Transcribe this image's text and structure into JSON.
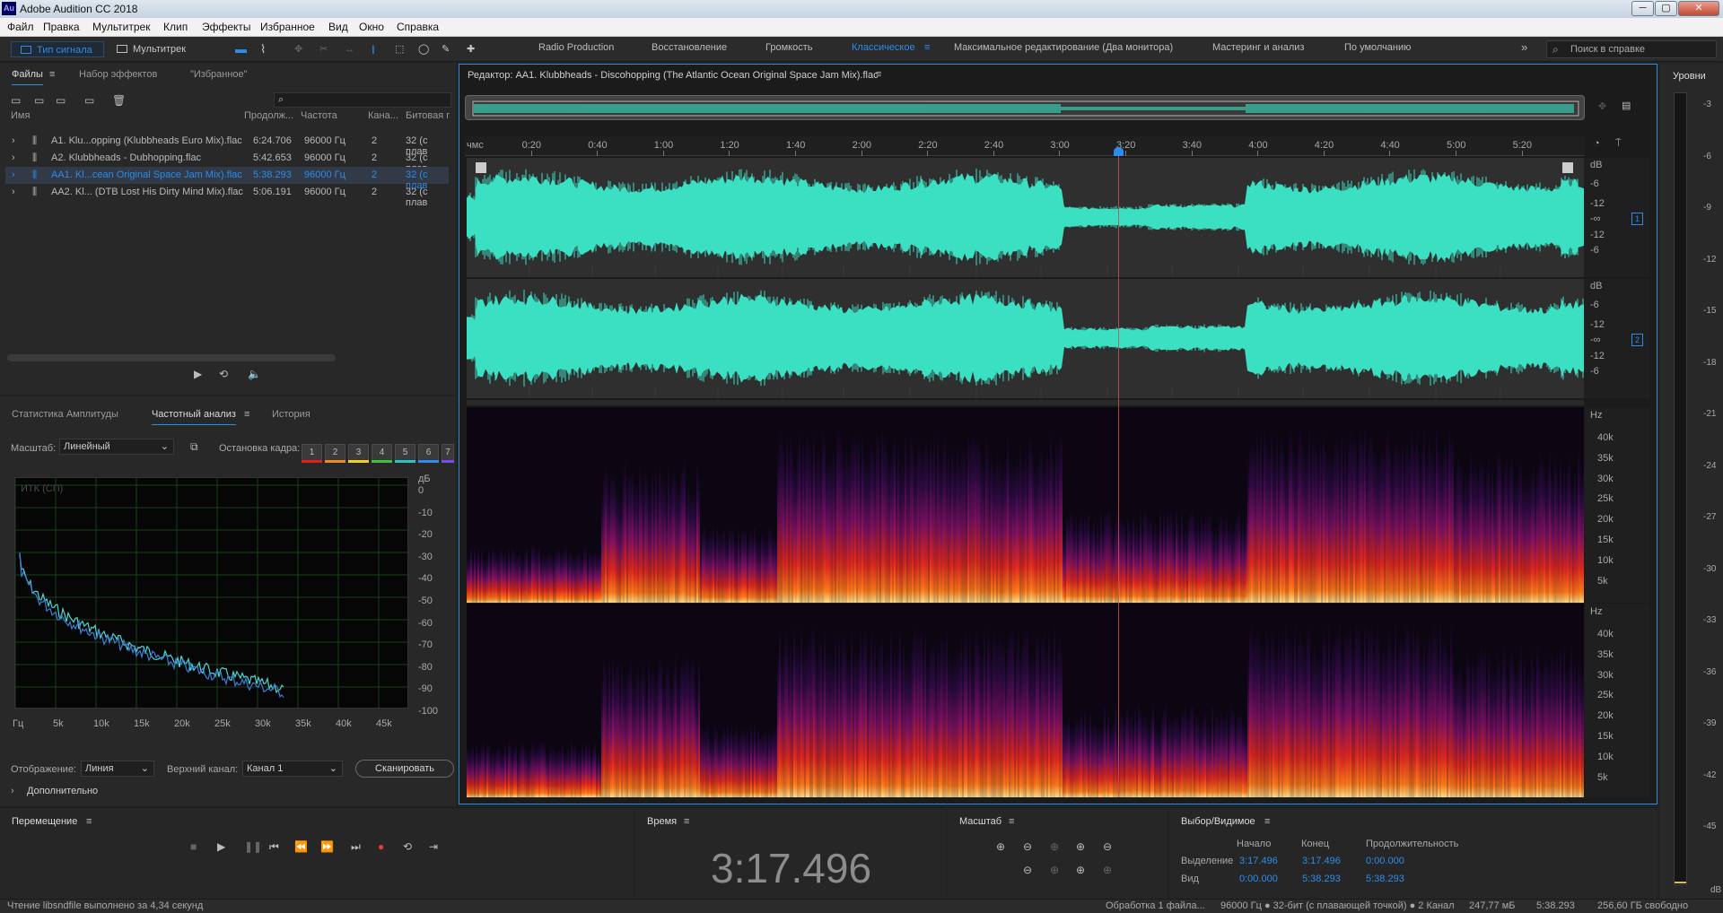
{
  "window": {
    "title": "Adobe Audition CC 2018",
    "logo": "Au",
    "min": "─",
    "max": "▢",
    "close": "✕"
  },
  "menu": [
    "Файл",
    "Правка",
    "Мультитрек",
    "Клип",
    "Эффекты",
    "Избранное",
    "Вид",
    "Окно",
    "Справка"
  ],
  "toolbar": {
    "waveform_btn": "Тип сигнала",
    "multitrack_btn": "Мультитрек",
    "workspaces": [
      "Radio Production",
      "Восстановление",
      "Громкость",
      "Классическое",
      "Максимальное редактирование (Два монитора)",
      "Мастеринг и анализ",
      "По умолчанию"
    ],
    "active_workspace": "Классическое",
    "more": "»",
    "search_placeholder": "Поиск в справке"
  },
  "files_panel": {
    "tabs": [
      "Файлы",
      "Набор эффектов",
      "\"Избранное\""
    ],
    "columns": [
      "Имя",
      "Продолж...",
      "Частота",
      "Кана...",
      "Битовая г"
    ],
    "rows": [
      {
        "name": "A1. Klu...opping (Klubbheads Euro Mix).flac",
        "duration": "6:24.706",
        "rate": "96000 Гц",
        "channels": "2",
        "bits": "32 (с плав"
      },
      {
        "name": "A2. Klubbheads - Dubhopping.flac",
        "duration": "5:42.653",
        "rate": "96000 Гц",
        "channels": "2",
        "bits": "32 (с плав"
      },
      {
        "name": "AA1. Kl...cean Original Space Jam Mix).flac",
        "duration": "5:38.293",
        "rate": "96000 Гц",
        "channels": "2",
        "bits": "32 (с плав"
      },
      {
        "name": "AA2. Kl... (DTB Lost His Dirty Mind Mix).flac",
        "duration": "5:06.191",
        "rate": "96000 Гц",
        "channels": "2",
        "bits": "32 (с плав"
      }
    ],
    "selected_row": 2
  },
  "analysis_panel": {
    "tabs": [
      "Статистика Амплитуды",
      "Частотный анализ",
      "История"
    ],
    "scale_label": "Масштаб:",
    "scale_value": "Линейный",
    "freeze_label": "Остановка кадра:",
    "freeze_slots": [
      "1",
      "2",
      "3",
      "4",
      "5",
      "6",
      "7"
    ],
    "freeze_colors": [
      "#e02020",
      "#f08a1c",
      "#f0d21c",
      "#3cc23c",
      "#2cc2c2",
      "#2c8ef0",
      "#7a4af0"
    ],
    "graph_label": "ИТК (СП)",
    "db_unit": "дБ",
    "db_ticks": [
      "0",
      "-10",
      "-20",
      "-30",
      "-40",
      "-50",
      "-60",
      "-70",
      "-80",
      "-90",
      "-100"
    ],
    "freq_ticks": [
      "Гц",
      "5k",
      "10k",
      "15k",
      "20k",
      "25k",
      "30k",
      "35k",
      "40k",
      "45k"
    ],
    "display_label": "Отображение:",
    "display_value": "Линия",
    "channel_label": "Верхний канал:",
    "channel_value": "Канал 1",
    "scan_btn": "Сканировать",
    "advanced": "Дополнительно",
    "line_color": "#48d8d0"
  },
  "editor": {
    "title": "Редактор: AA1. Klubbheads - Discohopping (The Atlantic Ocean Original Space Jam Mix).flac",
    "time_unit": "чмс",
    "ruler": [
      "0:20",
      "0:40",
      "1:00",
      "1:20",
      "1:40",
      "2:00",
      "2:20",
      "2:40",
      "3:00",
      "3:20",
      "3:40",
      "4:00",
      "4:20",
      "4:40",
      "5:00",
      "5:20"
    ],
    "db_label": "dB",
    "db_ticks": [
      "-6",
      "-12",
      "-∞",
      "-12",
      "-6"
    ],
    "channel_badges": [
      "1",
      "2"
    ],
    "hz_label": "Hz",
    "hz_ticks": [
      "40k",
      "35k",
      "30k",
      "25k",
      "20k",
      "15k",
      "10k",
      "5k"
    ],
    "wave_color": "#3be0c3",
    "playhead": "3:17.496"
  },
  "transport": {
    "title": "Перемещение"
  },
  "time_panel": {
    "title": "Время",
    "value": "3:17.496"
  },
  "zoom_panel": {
    "title": "Масштаб"
  },
  "selection_panel": {
    "title": "Выбор/Видимое",
    "headers": [
      "Начало",
      "Конец",
      "Продолжительность"
    ],
    "rows": [
      {
        "label": "Выделение",
        "start": "3:17.496",
        "end": "3:17.496",
        "duration": "0:00.000"
      },
      {
        "label": "Вид",
        "start": "0:00.000",
        "end": "5:38.293",
        "duration": "5:38.293"
      }
    ]
  },
  "levels": {
    "title": "Уровни",
    "ticks": [
      "-3",
      "-6",
      "-9",
      "-12",
      "-15",
      "-18",
      "-21",
      "-24",
      "-27",
      "-30",
      "-33",
      "-36",
      "-39",
      "-42",
      "-45"
    ],
    "db": "dB"
  },
  "status": {
    "left": "Чтение libsndfile выполнено за 4,34 секунд",
    "processing": "Обработка 1 файла...",
    "format": "96000 Гц ● 32-бит (с плавающей точкой) ● 2 Канал",
    "size": "247,77 мБ",
    "duration": "5:38.293",
    "free": "256,60 ГБ свободно"
  }
}
